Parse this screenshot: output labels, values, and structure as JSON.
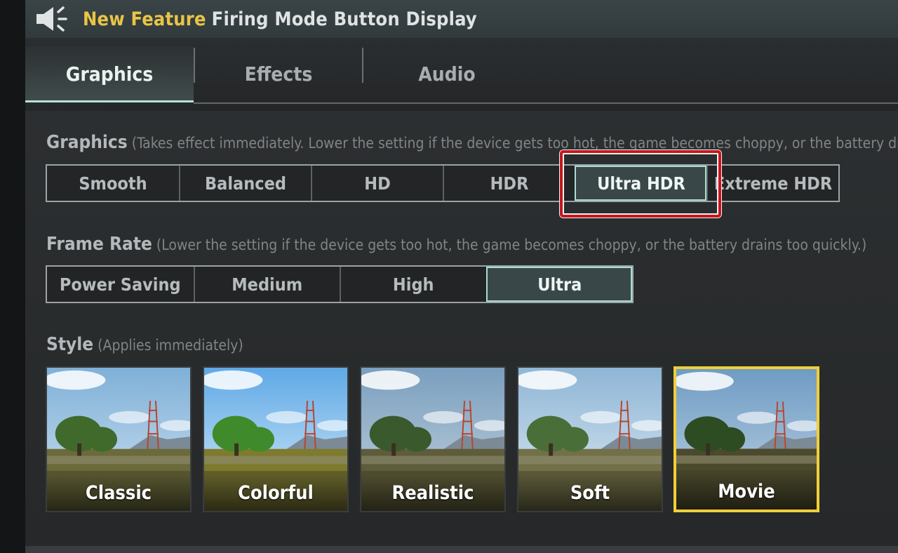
{
  "announcement": {
    "highlight": "New Feature",
    "text": "Firing Mode Button Display"
  },
  "tabs": [
    {
      "label": "Graphics",
      "active": true
    },
    {
      "label": "Effects",
      "active": false
    },
    {
      "label": "Audio",
      "active": false
    }
  ],
  "graphics": {
    "title": "Graphics",
    "note": "(Takes effect immediately. Lower the setting if the device gets too hot, the game becomes choppy, or the battery drain",
    "options": [
      "Smooth",
      "Balanced",
      "HD",
      "HDR",
      "Ultra HDR",
      "Extreme HDR"
    ],
    "selected": "Ultra HDR"
  },
  "frame_rate": {
    "title": "Frame Rate",
    "note": "(Lower the setting if the device gets too hot, the game becomes choppy, or the battery drains too quickly.)",
    "options": [
      "Power Saving",
      "Medium",
      "High",
      "Ultra"
    ],
    "selected": "Ultra"
  },
  "style": {
    "title": "Style",
    "note": "(Applies immediately)",
    "options": [
      "Classic",
      "Colorful",
      "Realistic",
      "Soft",
      "Movie"
    ],
    "selected": "Movie"
  },
  "colors": {
    "accent_teal": "#a8ddd2",
    "highlight_yellow": "#e8c547",
    "selected_border_yellow": "#f0cf39",
    "annotation_red": "#c8161c"
  },
  "icons": {
    "announcement": "speaker-icon"
  }
}
